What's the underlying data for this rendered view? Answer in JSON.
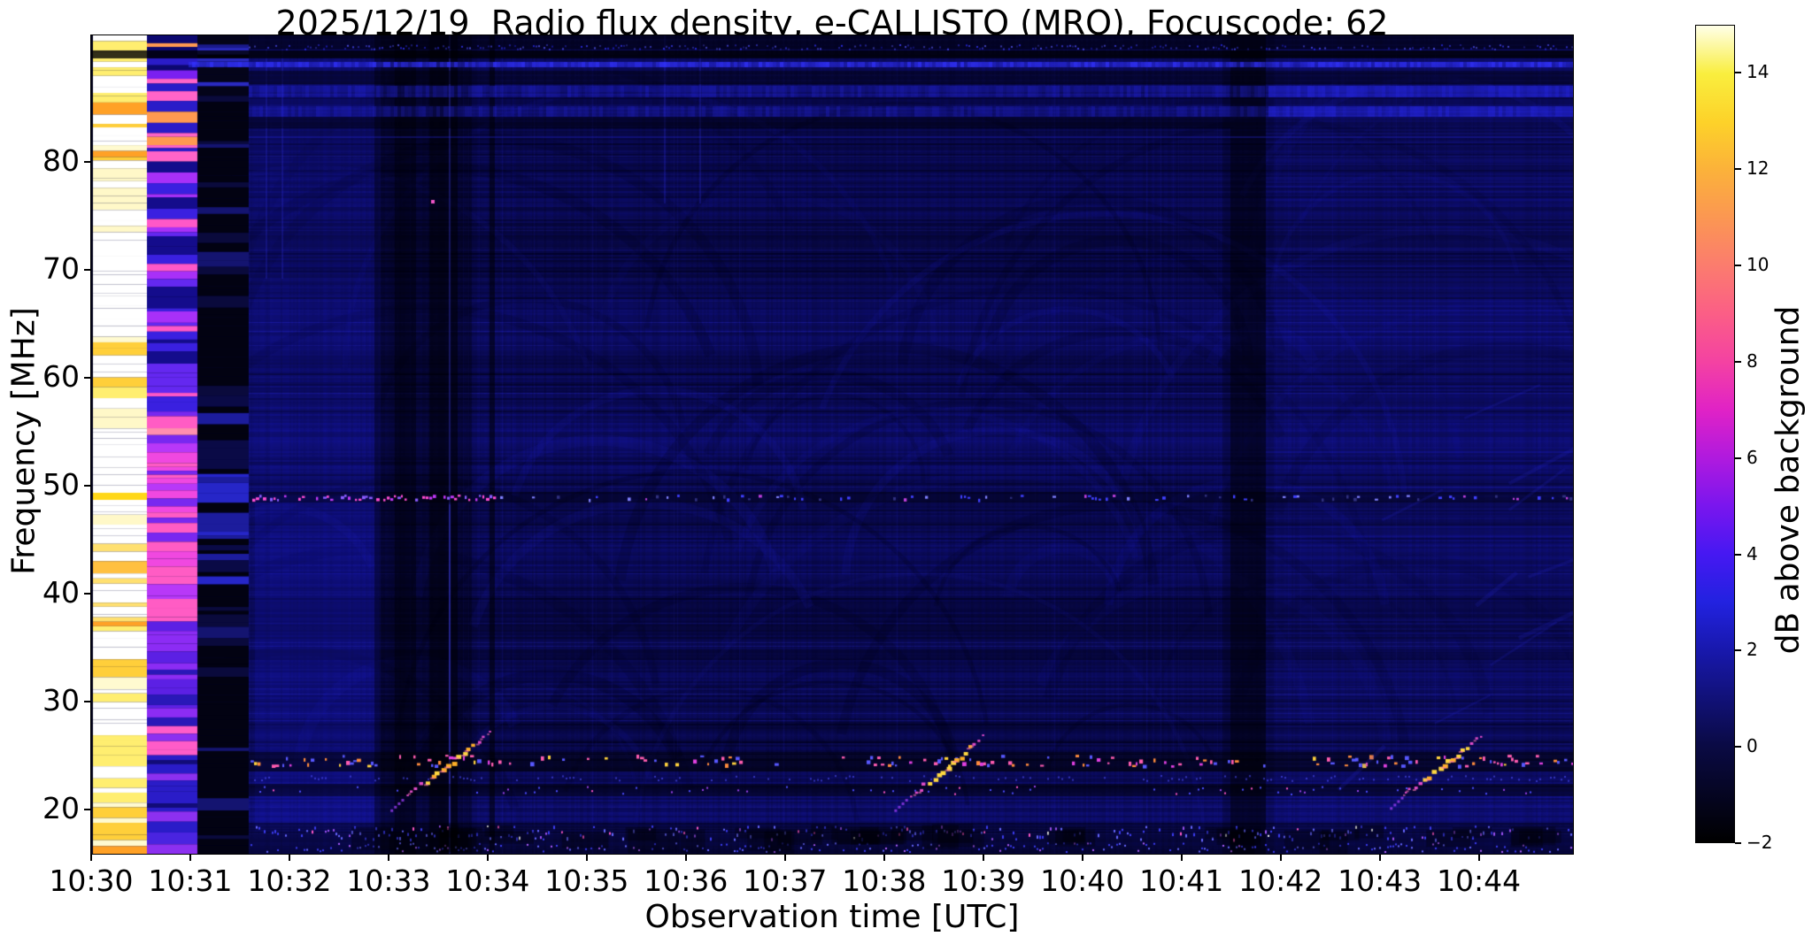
{
  "title": "2025/12/19  Radio flux density, e-CALLISTO (MRO), Focuscode: 62",
  "meta": {
    "date": "2025/12/19",
    "instrument": "e-CALLISTO (MRO)",
    "focuscode": "62"
  },
  "chart_data": {
    "type": "heatmap",
    "title": "2025/12/19  Radio flux density, e-CALLISTO (MRO), Focuscode: 62",
    "xlabel": "Observation time [UTC]",
    "ylabel": "Frequency [MHz]",
    "x_tick_labels": [
      "10:30",
      "10:31",
      "10:32",
      "10:33",
      "10:34",
      "10:35",
      "10:36",
      "10:37",
      "10:38",
      "10:39",
      "10:40",
      "10:41",
      "10:42",
      "10:43",
      "10:44"
    ],
    "x_tick_seconds": [
      0,
      60,
      120,
      180,
      240,
      300,
      360,
      420,
      480,
      540,
      600,
      660,
      720,
      780,
      840
    ],
    "x_range_seconds": [
      0,
      897
    ],
    "y_ticks_mhz": [
      20,
      30,
      40,
      50,
      60,
      70,
      80
    ],
    "y_range_mhz": [
      15.9,
      91.7
    ],
    "grid": false,
    "colorbar": {
      "label": "dB above background",
      "ticks": [
        14,
        12,
        10,
        8,
        6,
        4,
        2,
        0,
        -2
      ],
      "range": [
        -2,
        15
      ],
      "colormap": "gnuplot2-like (black-blue-violet-magenta-pink-orange-yellow-white)",
      "stops": [
        {
          "v": -2,
          "c": "#000000"
        },
        {
          "v": 0,
          "c": "#0a0a44"
        },
        {
          "v": 2,
          "c": "#1818ac"
        },
        {
          "v": 3,
          "c": "#2222e0"
        },
        {
          "v": 4,
          "c": "#4618f2"
        },
        {
          "v": 5,
          "c": "#7a16ee"
        },
        {
          "v": 6,
          "c": "#b01ade"
        },
        {
          "v": 7,
          "c": "#e022c6"
        },
        {
          "v": 8,
          "c": "#f442a2"
        },
        {
          "v": 9,
          "c": "#fb5e86"
        },
        {
          "v": 10,
          "c": "#fb7c6e"
        },
        {
          "v": 11,
          "c": "#fb9752"
        },
        {
          "v": 12,
          "c": "#fbb23a"
        },
        {
          "v": 13,
          "c": "#fdd229"
        },
        {
          "v": 14,
          "c": "#f9ee3e"
        },
        {
          "v": 15,
          "c": "#ffffe8"
        }
      ]
    },
    "base_field_color": "#0a0a50",
    "features": {
      "calibration_columns": [
        {
          "t": [
            0,
            34
          ],
          "desc": "saturated white/yellow striped column"
        },
        {
          "t": [
            34,
            64
          ],
          "desc": "pink/magenta/violet striped column"
        },
        {
          "t": [
            64,
            95
          ],
          "desc": "near-black quiet column"
        }
      ],
      "bright_time_band_s": [
        95,
        175
      ],
      "dark_time_bands_s": [
        [
          171,
          229
        ],
        [
          241,
          244
        ],
        [
          690,
          711
        ]
      ],
      "rfi_lines_mhz": [
        87.2,
        84.5,
        49.0,
        24.6,
        21.9,
        18.8,
        17.6
      ],
      "drifting_bursts": [
        {
          "t": [
            190,
            240
          ],
          "f": [
            21.3,
            27.2
          ]
        },
        {
          "t": [
            495,
            540
          ],
          "f": [
            21.3,
            26.8
          ]
        },
        {
          "t": [
            795,
            840
          ],
          "f": [
            21.5,
            27.0
          ]
        }
      ]
    }
  }
}
